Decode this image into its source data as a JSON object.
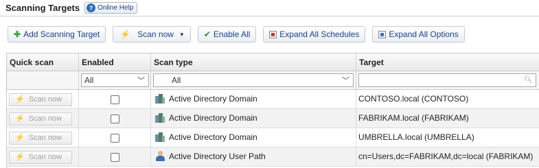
{
  "header": {
    "title": "Scanning Targets",
    "help_label": "Online Help"
  },
  "toolbar": {
    "add_label": "Add Scanning Target",
    "scan_now_label": "Scan now",
    "enable_all_label": "Enable All",
    "expand_schedules_label": "Expand All Schedules",
    "expand_options_label": "Expand All Options"
  },
  "grid": {
    "columns": [
      "Quick scan",
      "Enabled",
      "Scan type",
      "Target"
    ],
    "filters": {
      "enabled": "All",
      "scan_type": "All",
      "target": ""
    },
    "rows": [
      {
        "quick_scan": "Scan now",
        "enabled": false,
        "scan_type": "Active Directory Domain",
        "icon": "ad-domain-icon",
        "target": "CONTOSO.local (CONTOSO)"
      },
      {
        "quick_scan": "Scan now",
        "enabled": false,
        "scan_type": "Active Directory Domain",
        "icon": "ad-domain-icon",
        "target": "FABRIKAM.local (FABRIKAM)"
      },
      {
        "quick_scan": "Scan now",
        "enabled": false,
        "scan_type": "Active Directory Domain",
        "icon": "ad-domain-icon",
        "target": "UMBRELLA.local (UMBRELLA)"
      },
      {
        "quick_scan": "Scan now",
        "enabled": false,
        "scan_type": "Active Directory User Path",
        "icon": "ad-user-icon",
        "target": "cn=Users,dc=FABRIKAM,dc=local (FABRIKAM)"
      }
    ]
  }
}
